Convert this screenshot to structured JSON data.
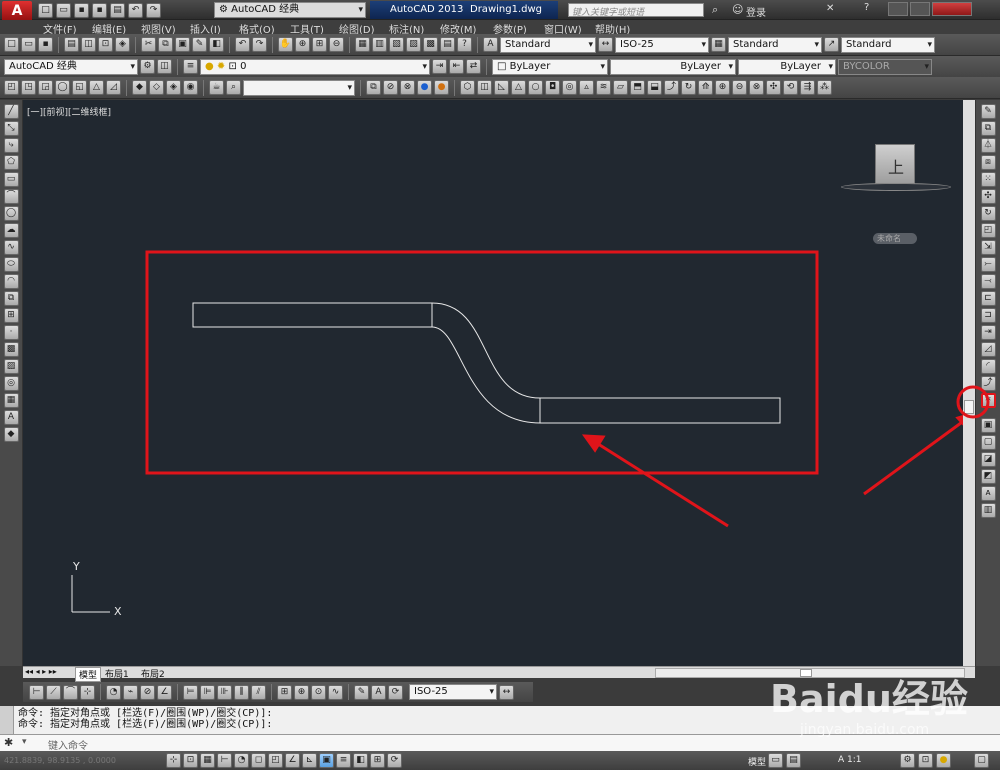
{
  "titlebar": {
    "workspace": "AutoCAD 经典",
    "app_title": "AutoCAD 2013",
    "doc_title": "Drawing1.dwg",
    "search_placeholder": "键入关键字或短语",
    "login": "登录"
  },
  "menu": [
    "文件(F)",
    "编辑(E)",
    "视图(V)",
    "插入(I)",
    "格式(O)",
    "工具(T)",
    "绘图(D)",
    "标注(N)",
    "修改(M)",
    "参数(P)",
    "窗口(W)",
    "帮助(H)"
  ],
  "styles_toolbar": {
    "text_style": "Standard",
    "dim_style": "ISO-25",
    "table_style": "Standard",
    "mleader_style": "Standard"
  },
  "workspace_toolbar": {
    "workspace": "AutoCAD 经典",
    "layer": "0"
  },
  "properties_toolbar": {
    "color": "ByLayer",
    "linetype": "ByLayer",
    "lineweight": "ByLayer",
    "plotstyle": "BYCOLOR"
  },
  "viewport": {
    "label": "[一][前视][二维线框]",
    "viewcube_face": "上",
    "wcs_label": "未命名",
    "ucs_x": "X",
    "ucs_y": "Y"
  },
  "tabs": [
    "模型",
    "布局1",
    "布局2"
  ],
  "dim_toolbar": {
    "dim_style": "ISO-25"
  },
  "command_history": [
    "命令: 指定对角点或 [栏选(F)/圈围(WP)/圈交(CP)]:",
    "命令: 指定对角点或 [栏选(F)/圈围(WP)/圈交(CP)]:"
  ],
  "command_prompt": "键入命令",
  "status": {
    "coords": "421.8839, 98.9135 , 0.0000",
    "model": "模型",
    "scale": "A 1:1"
  },
  "watermark": {
    "brand": "Baidu经验",
    "url": "jingyan.baidu.com"
  },
  "colors": {
    "canvas": "#212830",
    "annotation": "#e0141a",
    "geometry": "#e8e8e8"
  }
}
